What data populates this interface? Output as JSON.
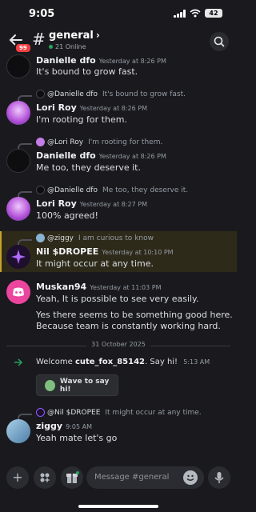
{
  "status": {
    "time": "9:05",
    "battery": "42"
  },
  "header": {
    "unread_badge": "99",
    "channel": "general",
    "chevron": "›",
    "hash": "#",
    "online": "21 Online"
  },
  "messages": {
    "m1": {
      "author": "Danielle dfo",
      "timestamp": "Yesterday at 8:26 PM",
      "text": "It's bound to grow fast."
    },
    "m2": {
      "reply_name": "@Danielle dfo",
      "reply_text": "It's bound to grow fast.",
      "author": "Lori Roy",
      "timestamp": "Yesterday at 8:26 PM",
      "text": "I'm rooting for them."
    },
    "m3": {
      "reply_name": "@Lori Roy",
      "reply_text": "I'm rooting for them.",
      "author": "Danielle dfo",
      "timestamp": "Yesterday at 8:26 PM",
      "text": "Me too, they deserve it."
    },
    "m4": {
      "reply_name": "@Danielle dfo",
      "reply_text": "Me too, they deserve it.",
      "author": "Lori Roy",
      "timestamp": "Yesterday at 8:27 PM",
      "text": "100% agreed!"
    },
    "m5": {
      "reply_name": "@ziggy",
      "reply_text": "I am curious to know",
      "author": "Nil $DROPEE",
      "timestamp": "Yesterday at 10:10 PM",
      "text": "It might occur at any time."
    },
    "m6": {
      "author": "Muskan94",
      "timestamp": "Yesterday at 11:03 PM",
      "text": "Yeah, It is possible to see very easily.",
      "text2": "Yes there seems to be something good here.",
      "text3": "Because team is constantly working hard."
    },
    "divider": "31 October 2025",
    "welcome": {
      "prefix": "Welcome",
      "username": "cute_fox_85142",
      "suffix": ". Say hi!",
      "timestamp": "5:13 AM",
      "button": "Wave to say hi!"
    },
    "m7": {
      "reply_name": "@Nil $DROPEE",
      "reply_text": "It might occur at any time.",
      "author": "ziggy",
      "timestamp": "9:05 AM",
      "text": "Yeah mate let's go"
    }
  },
  "composer": {
    "placeholder": "Message #general",
    "add": "+"
  },
  "colors": {
    "accent_blurple": "#5865f2",
    "online_green": "#23a55a",
    "badge_red": "#f23f43",
    "highlight_gold": "#c9a227"
  }
}
